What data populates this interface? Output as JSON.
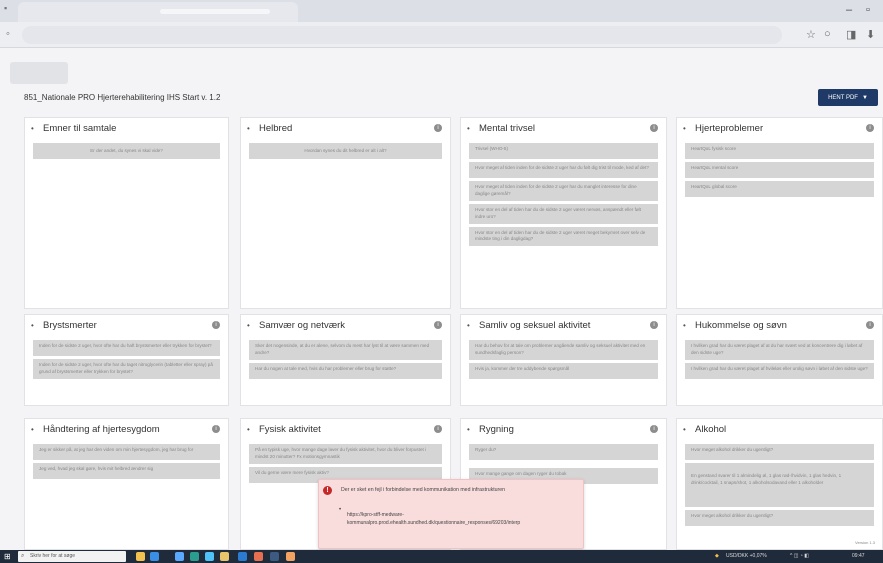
{
  "browser": {
    "minimize_glyph": "–",
    "maximize_glyph": "▫",
    "address_icons": [
      "☆",
      "○",
      "◨",
      "⬇"
    ]
  },
  "page": {
    "title": "851_Nationale PRO Hjerterehabilitering IHS Start v. 1.2",
    "pdf_button": "HENT PDF",
    "pdf_caret": "▼",
    "version": "Version 1.3"
  },
  "cards": [
    {
      "title": "Emner til samtale",
      "questions": [
        "Er der andet, du synes vi skal vide?"
      ]
    },
    {
      "title": "Helbred",
      "questions": [
        "Hvordan synes du dit helbred er alt i alt?"
      ]
    },
    {
      "title": "Mental trivsel",
      "questions": [
        "Trivsel (WHO-5)",
        "Hvor meget af tiden inden for de sidste 2 uger har du følt dig trist til mode, ked af det?",
        "Hvor meget af tiden inden for de sidste 2 uger har du manglet interesse for dine daglige gøremål?",
        "Hvor stor en del af tiden har du de sidste 2 uger været nervøs, anspændt eller følt indre uro?",
        "Hvor stor en del af tiden har du de sidste 2 uger været meget bekymret over selv de mindste ting i din dagligdag?"
      ]
    },
    {
      "title": "Hjerteproblemer",
      "questions": [
        "HeartQoL fysisk score",
        "HeartQoL mental score",
        "HeartQoL global score"
      ]
    },
    {
      "title": "Brystsmerter",
      "questions": [
        "Inden for de sidste 2 uger, hvor ofte har du haft brystsmerter eller trykken for brystet?",
        "Inden for de sidste 2 uger, hvor ofte har du taget nitroglycerin (tabletter eller spray) på grund af brystsmerter eller trykken for brystet?"
      ]
    },
    {
      "title": "Samvær og netværk",
      "questions": [
        "Sker det nogensinde, at du er alene, selvom du mest har lyst til at være sammen med andre?",
        "Har du nogen at tale med, hvis du har problemer eller brug for støtte?"
      ]
    },
    {
      "title": "Samliv og seksuel aktivitet",
      "questions": [
        "Har du behov for at tale om problemer angående samliv og seksuel aktivitet med en sundhedsfaglig person?",
        "Hvis ja, kommer der tre uddybende spørgsmål"
      ]
    },
    {
      "title": "Hukommelse og søvn",
      "questions": [
        "I hvilken grad har du været plaget af at du har svært ved at koncentrere dig i løbet af den sidste uge?",
        "I hvilken grad har du været plaget af hvileløs eller urolig søvn i løbet af den sidste uge?"
      ]
    },
    {
      "title": "Håndtering af hjertesygdom",
      "questions": [
        "Jeg er sikker på, at jeg har den viden om min hjertesygdom, jeg har brug for",
        "Jeg ved, hvad jeg skal gøre, hvis mit helbred ændrer sig"
      ]
    },
    {
      "title": "Fysisk aktivitet",
      "questions": [
        "På en typisk uge, hvor mange dage laver du fysisk aktivitet, hvor du bliver forpustet i mindst 20 minutter? Fx motionsgymnastik",
        "Vil du gerne være mere fysisk aktiv?"
      ]
    },
    {
      "title": "Rygning",
      "questions": [
        "Ryger du?",
        "Hvor mange gange om dagen ryger du tobak"
      ]
    },
    {
      "title": "Alkohol",
      "questions": [
        "Hvor meget alkohol drikker du ugentligt?",
        "En genstand svarer til 1 almindelig øl, 1 glas rød-/hvidvin, 1 glas hedvin, 1 drink/cocktail, 1 snaps/shot, 1 alkoholsodavand eller 1 alkoholder",
        "Hvor meget alkohol drikker du ugentligt?"
      ]
    }
  ],
  "error": {
    "message": "Der er sket en fejl i forbindelse med kommunikation med infrastrukturen",
    "bullet": "•",
    "url": "https://kpro-stff-medware-kommunalpro.prod.ehealth.sundhed.dk/questionnaire_responses/69203/interp"
  },
  "taskbar": {
    "search_placeholder": "Skriv her for at søge",
    "tray_text": "USD/DKK +0,07%",
    "clock": "09:47"
  }
}
